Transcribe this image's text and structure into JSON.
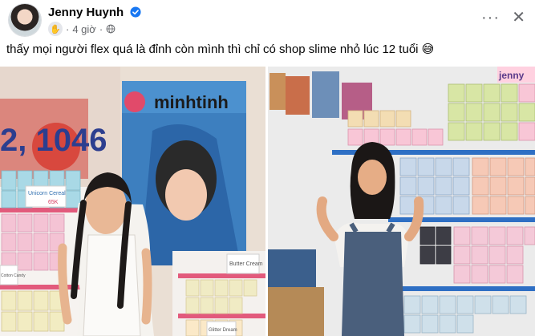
{
  "post": {
    "author": "Jenny Huynh",
    "time": "4 giờ",
    "caption": "thấy mọi người flex quá là đỉnh còn mình thì chỉ có shop slime nhỏ lúc 12 tuổi 😅",
    "more_icon": "more-horizontal-icon",
    "close_icon": "close-icon",
    "verified_icon": "verified-badge-icon",
    "audience_icon": "globe-icon"
  },
  "photos": {
    "left": {
      "store_sign": "minhtinh",
      "wall_text": "2, 1046",
      "label_1": "Unicorn Cereal",
      "price_1": "65K",
      "label_2": "Butter Cream",
      "label_3": "Glitter Dream",
      "label_4": "Cotton Candy"
    },
    "right": {
      "shelf_sign": "jenny"
    }
  },
  "colors": {
    "accent": "#1877f2",
    "text_secondary": "#65676b"
  }
}
